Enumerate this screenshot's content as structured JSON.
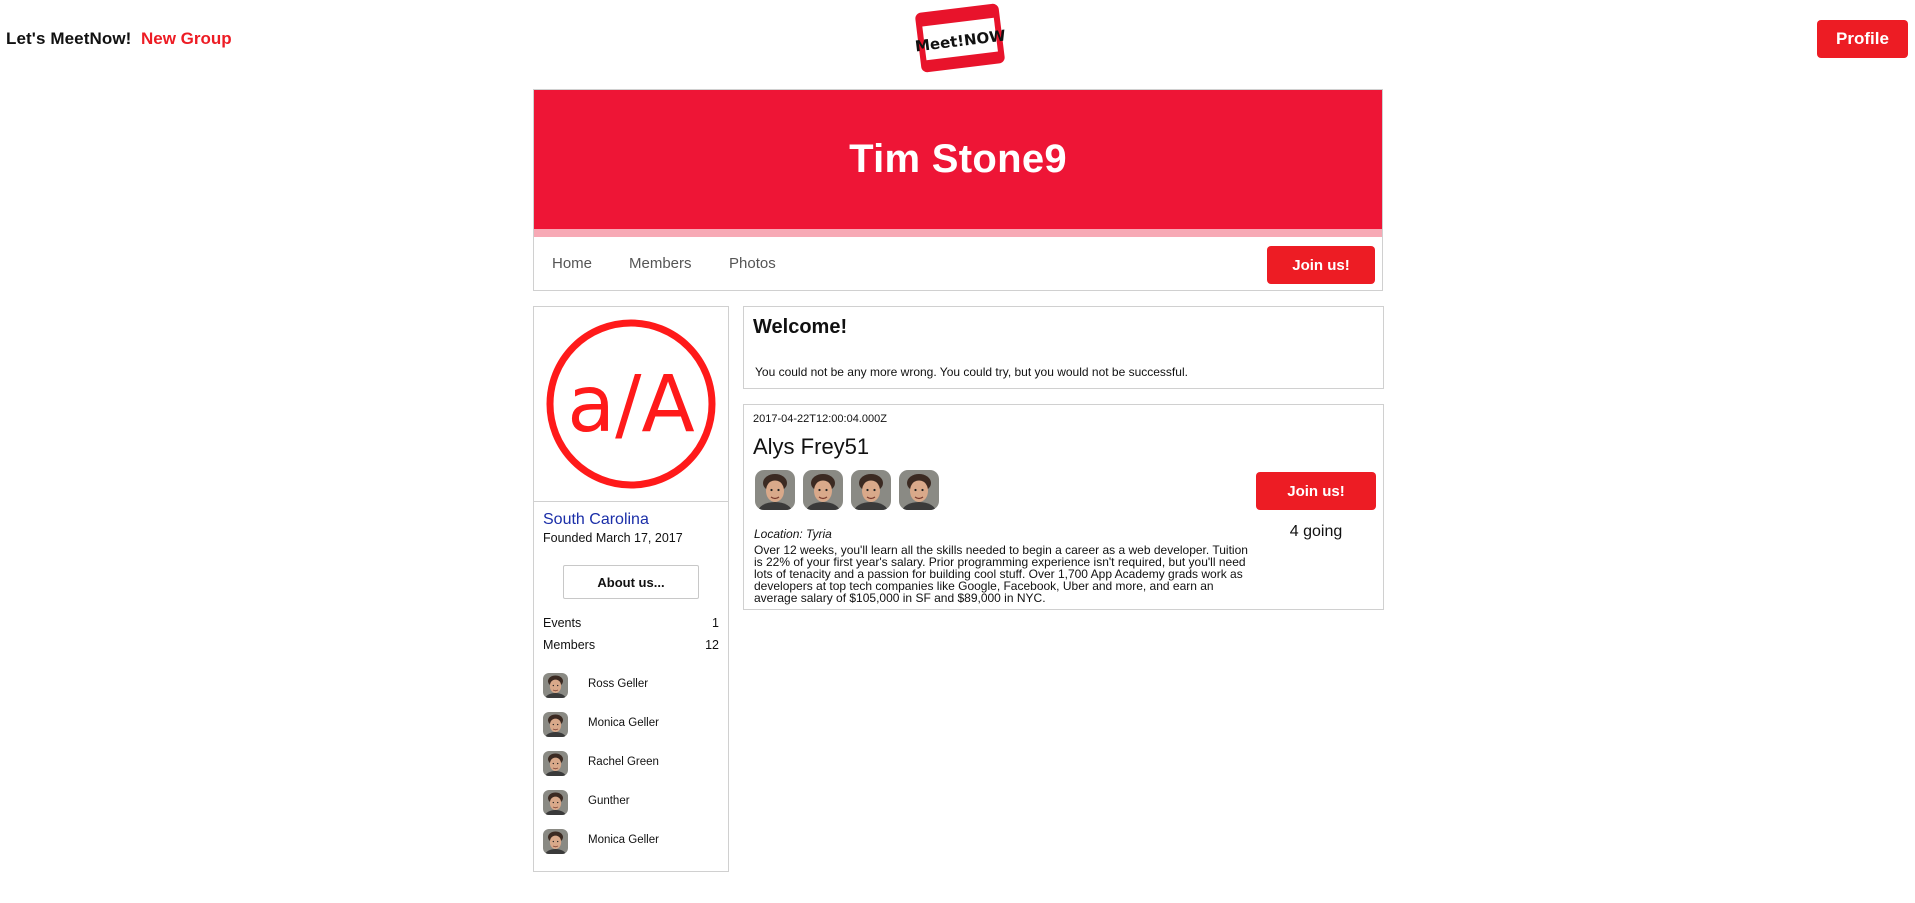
{
  "nav": {
    "brand": "Let's MeetNow!",
    "new_group": "New Group",
    "logo_text": "Meet!NOW",
    "profile": "Profile"
  },
  "group": {
    "title": "Tim Stone9",
    "tabs": [
      "Home",
      "Members",
      "Photos"
    ],
    "join_label": "Join us!"
  },
  "sidebar": {
    "logo_text": "a/A",
    "location": "South Carolina",
    "founded": "Founded March 17, 2017",
    "about_button": "About us...",
    "stats": [
      {
        "label": "Events",
        "value": "1"
      },
      {
        "label": "Members",
        "value": "12"
      }
    ],
    "members": [
      "Ross Geller",
      "Monica Geller",
      "Rachel Green",
      "Gunther",
      "Monica Geller"
    ]
  },
  "welcome": {
    "title": "Welcome!",
    "text": "You could not be any more wrong. You could try, but you would not be successful."
  },
  "event": {
    "date": "2017-04-22T12:00:04.000Z",
    "title": "Alys Frey51",
    "attendee_count": 4,
    "location": "Location: Tyria",
    "description": "Over 12 weeks, you'll learn all the skills needed to begin a career as a web developer. Tuition is 22% of your first year's salary. Prior programming experience isn't required, but you'll need lots of tenacity and a passion for building cool stuff. Over 1,700 App Academy grads work as developers at top tech companies like Google, Facebook, Uber and more, and earn an average salary of $105,000 in SF and $89,000 in NYC.",
    "join_label": "Join us!",
    "going": "4 going"
  },
  "colors": {
    "brand_red": "#ed1c24",
    "banner_red": "#ee1536",
    "banner_stripe": "#f7a9b5",
    "location_blue": "#1a2ea8"
  },
  "icons": {
    "logo": "meetnow-name-tag-logo",
    "group_logo": "app-academy-logo",
    "avatar": "user-avatar"
  }
}
